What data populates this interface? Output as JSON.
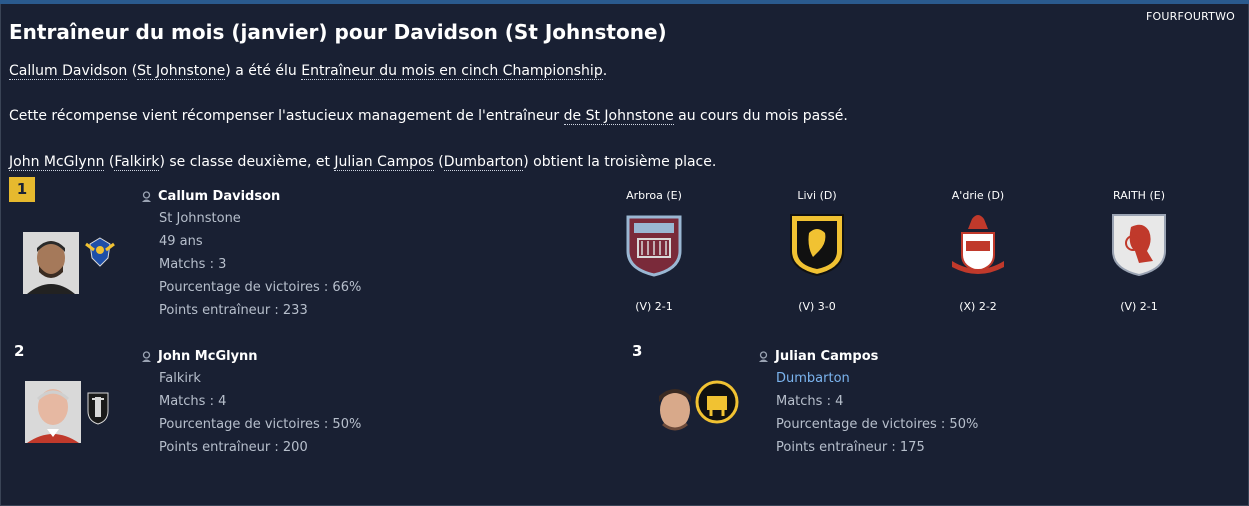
{
  "source": "FOURFOURTWO",
  "title": "Entraîneur du mois (janvier) pour Davidson (St Johnstone)",
  "para1": {
    "coach": "Callum Davidson",
    "open": " (",
    "club": "St Johnstone",
    "mid": ") a été élu ",
    "award": "Entraîneur du mois en cinch Championship",
    "end": "."
  },
  "para2": {
    "start": "Cette récompense vient récompenser l'astucieux management de l'entraîneur ",
    "club": "de St Johnstone",
    "end": " au cours du mois passé."
  },
  "para3": {
    "p2": "John McGlynn",
    "p2club": "Falkirk",
    "mid": ") se classe deuxième, et ",
    "p3": "Julian Campos",
    "p3club": "Dumbarton",
    "end": ") obtient la troisième place."
  },
  "winner": {
    "rank": "1",
    "name": "Callum Davidson",
    "club": "St Johnstone",
    "age": "49 ans",
    "matches": "Matchs : 3",
    "winpct": "Pourcentage de victoires : 66%",
    "points": "Points entraîneur : 233"
  },
  "second": {
    "rank": "2",
    "name": "John McGlynn",
    "club": "Falkirk",
    "matches": "Matchs : 4",
    "winpct": "Pourcentage de victoires : 50%",
    "points": "Points entraîneur : 200"
  },
  "third": {
    "rank": "3",
    "name": "Julian Campos",
    "club": "Dumbarton",
    "matches": "Matchs : 4",
    "winpct": "Pourcentage de victoires : 50%",
    "points": "Points entraîneur : 175"
  },
  "matches": [
    {
      "opponent": "Arbroa (E)",
      "result": "(V) 2-1"
    },
    {
      "opponent": "Livi (D)",
      "result": "(V) 3-0"
    },
    {
      "opponent": "A'drie (D)",
      "result": "(X) 2-2"
    },
    {
      "opponent": "RAITH (E)",
      "result": "(V) 2-1"
    }
  ],
  "colors": {
    "background": "#192033",
    "rank1_badge": "#e6b92e",
    "link": "#7bb4ef",
    "secondary_text": "#b7bfcc"
  }
}
